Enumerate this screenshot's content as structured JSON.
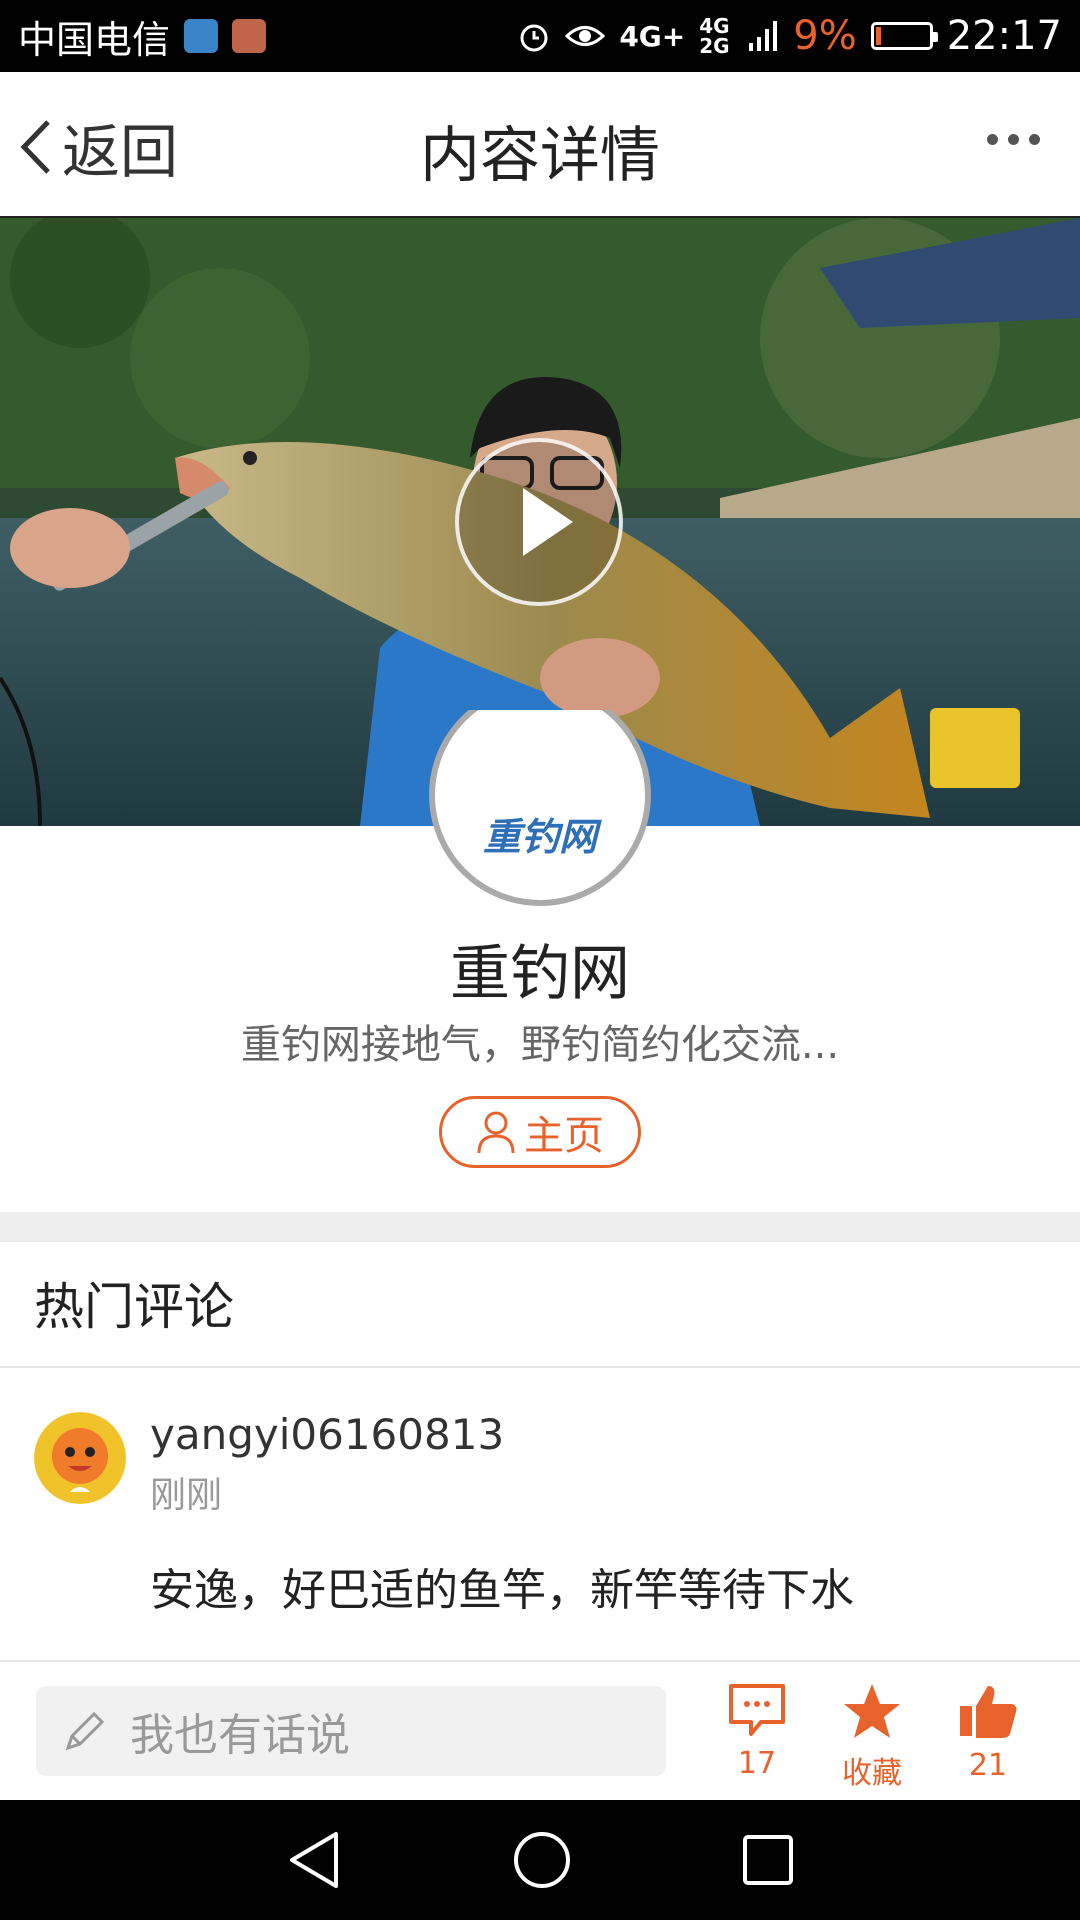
{
  "status_bar": {
    "carrier": "中国电信",
    "network": "4G+",
    "network_secondary": "4G 2G",
    "battery": "9%",
    "time": "22:17",
    "battery_color": "#e8622b"
  },
  "header": {
    "back_label": "返回",
    "title": "内容详情"
  },
  "author": {
    "logo_text": "重钓网",
    "name": "重钓网",
    "description": "重钓网接地气，野钓简约化交流...",
    "home_label": "主页"
  },
  "comments": {
    "section_title": "热门评论",
    "items": [
      {
        "username": "yangyi06160813",
        "time": "刚刚",
        "text": "安逸，好巴适的鱼竿，新竿等待下水"
      }
    ]
  },
  "bottom_bar": {
    "input_placeholder": "我也有话说",
    "comment_count": "17",
    "favorite_label": "收藏",
    "like_count": "21"
  },
  "colors": {
    "accent": "#e8622b"
  }
}
